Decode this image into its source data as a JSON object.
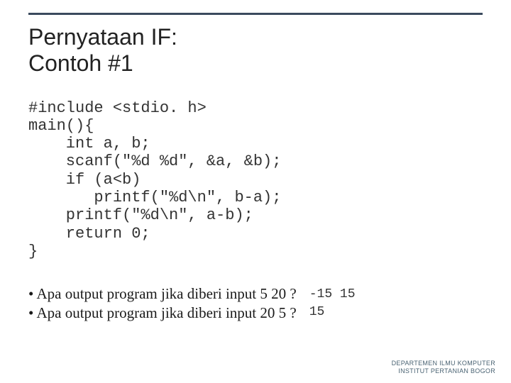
{
  "title_line1": "Pernyataan IF:",
  "title_line2": "Contoh #1",
  "code": "#include <stdio. h>\nmain(){\n    int a, b;\n    scanf(\"%d %d\", &a, &b);\n    if (a<b)\n       printf(\"%d\\n\", b-a);\n    printf(\"%d\\n\", a-b);\n    return 0;\n}",
  "questions": [
    "Apa output program jika diberi input 5 20 ?",
    "Apa output program jika diberi input 20 5 ?"
  ],
  "answers": "-15 15\n15",
  "footer_line1": "DEPARTEMEN ILMU KOMPUTER",
  "footer_line2": "INSTITUT PERTANIAN BOGOR"
}
